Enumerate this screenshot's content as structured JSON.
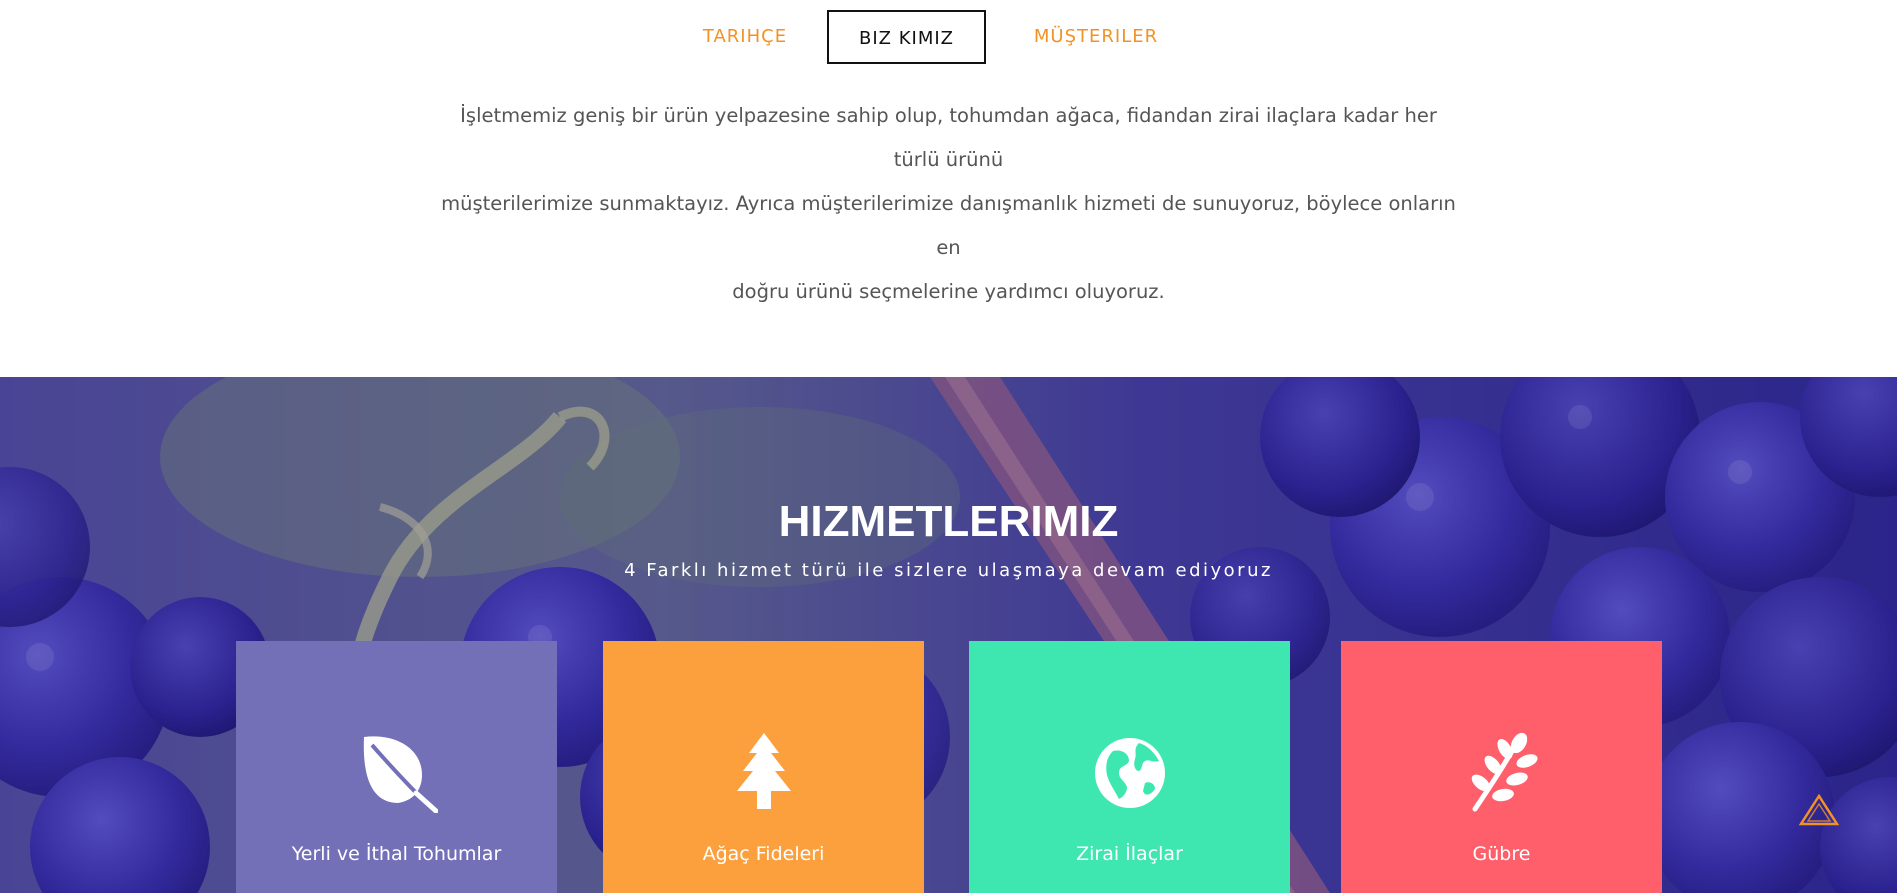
{
  "tabs": [
    {
      "label": "TARIHÇE",
      "active": false
    },
    {
      "label": "BIZ KIMIZ",
      "active": true
    },
    {
      "label": "MÜŞTERILER",
      "active": false
    }
  ],
  "intro": {
    "lines": [
      "İşletmemiz geniş bir ürün yelpazesine sahip olup, tohumdan ağaca, fidandan zirai ilaçlara kadar her türlü ürünü",
      "müşterilerimize sunmaktayız. Ayrıca müşterilerimize danışmanlık hizmeti de sunuyoruz, böylece onların en",
      "doğru ürünü seçmelerine yardımcı oluyoruz."
    ]
  },
  "services": {
    "title": "HIZMETLERIMIZ",
    "subtitle": "4 Farklı hizmet türü ile sizlere ulaşmaya devam ediyoruz",
    "cards": [
      {
        "label": "Yerli ve İthal Tohumlar",
        "icon": "leaf-icon",
        "color": "#7370b8"
      },
      {
        "label": "Ağaç Fideleri",
        "icon": "pine-tree-icon",
        "color": "#fca03e"
      },
      {
        "label": "Zirai İlaçlar",
        "icon": "globe-icon",
        "color": "#3ee7b0"
      },
      {
        "label": "Gübre",
        "icon": "plant-sprig-icon",
        "color": "#fe5f6a"
      }
    ]
  },
  "colors": {
    "accent": "#f39224",
    "active_tab": "#111111",
    "body_text": "#555555"
  },
  "back_to_top": {
    "icon": "triangle-up-icon"
  }
}
